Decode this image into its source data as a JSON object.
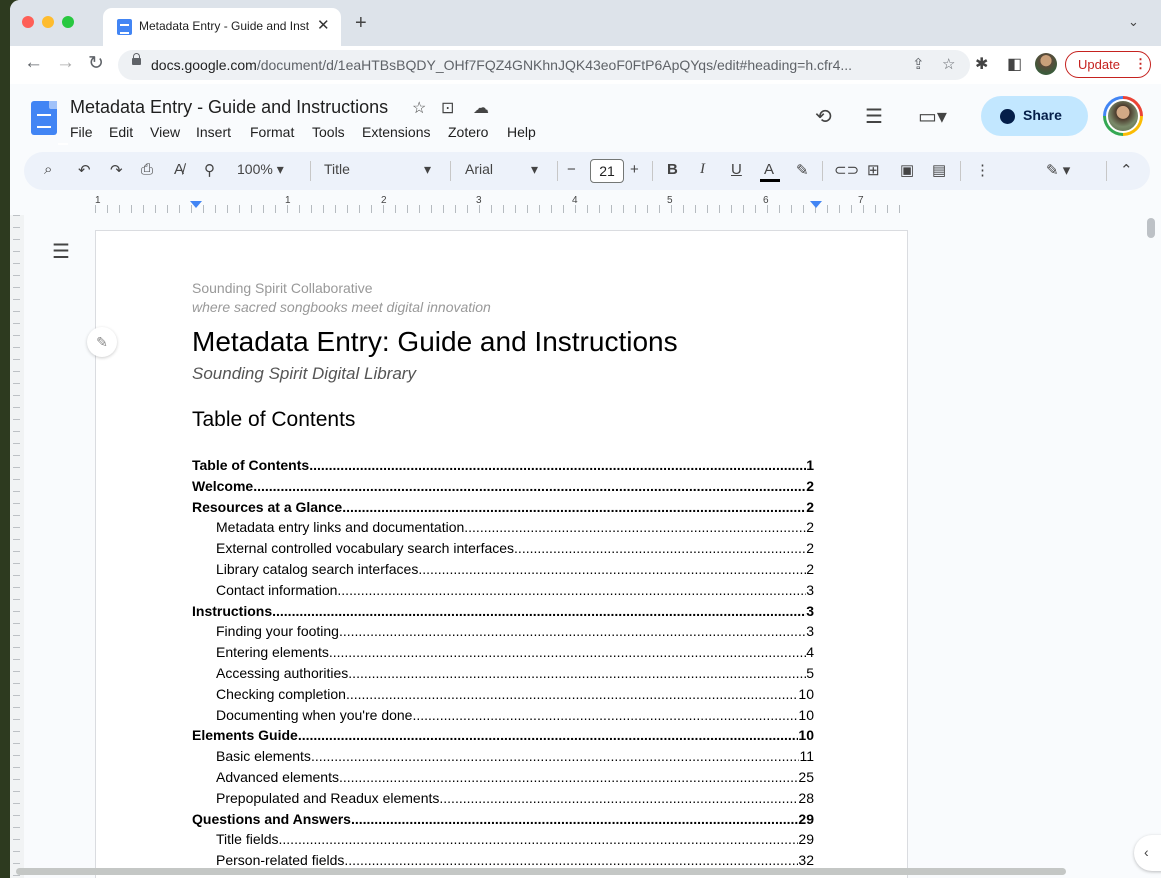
{
  "tab": {
    "title": "Metadata Entry - Guide and Instructions"
  },
  "browser": {
    "url_host": "docs.google.com",
    "url_path": "/document/d/1eaHTBsBQDY_OHf7FQZ4GNKhnJQK43eoF0FtP6ApQYqs/edit#heading=h.cfr4...",
    "update_label": "Update"
  },
  "docs": {
    "title": "Metadata Entry - Guide and Instructions",
    "menu": [
      "File",
      "Edit",
      "View",
      "Insert",
      "Format",
      "Tools",
      "Extensions",
      "Zotero",
      "Help"
    ],
    "share_label": "Share"
  },
  "toolbar": {
    "zoom": "100%",
    "style": "Title",
    "font": "Arial",
    "font_size": "21"
  },
  "ruler": {
    "numbers": [
      "1",
      "1",
      "2",
      "3",
      "4",
      "5",
      "6",
      "7"
    ]
  },
  "document": {
    "org_name": "Sounding Spirit Collaborative",
    "org_tagline": "where sacred songbooks meet digital innovation",
    "title": "Metadata Entry: Guide and Instructions",
    "subtitle": "Sounding Spirit Digital Library",
    "toc_heading": "Table of Contents",
    "toc": [
      {
        "text": "Table of Contents",
        "page": "1",
        "level": 1
      },
      {
        "text": "Welcome",
        "page": "2",
        "level": 1
      },
      {
        "text": "Resources at a Glance",
        "page": "2",
        "level": 1
      },
      {
        "text": "Metadata entry links and documentation",
        "page": "2",
        "level": 2
      },
      {
        "text": "External controlled vocabulary search interfaces",
        "page": "2",
        "level": 2
      },
      {
        "text": "Library catalog search interfaces",
        "page": "2",
        "level": 2
      },
      {
        "text": "Contact information",
        "page": "3",
        "level": 2
      },
      {
        "text": "Instructions",
        "page": "3",
        "level": 1
      },
      {
        "text": "Finding your footing",
        "page": "3",
        "level": 2
      },
      {
        "text": "Entering elements",
        "page": "4",
        "level": 2
      },
      {
        "text": "Accessing authorities",
        "page": "5",
        "level": 2
      },
      {
        "text": "Checking completion",
        "page": "10",
        "level": 2
      },
      {
        "text": "Documenting when you're done",
        "page": "10",
        "level": 2
      },
      {
        "text": "Elements Guide",
        "page": "10",
        "level": 1
      },
      {
        "text": "Basic elements",
        "page": "11",
        "level": 2
      },
      {
        "text": "Advanced elements",
        "page": "25",
        "level": 2
      },
      {
        "text": "Prepopulated and Readux elements",
        "page": "28",
        "level": 2
      },
      {
        "text": "Questions and Answers",
        "page": "29",
        "level": 1
      },
      {
        "text": "Title fields",
        "page": "29",
        "level": 2
      },
      {
        "text": "Person-related fields",
        "page": "32",
        "level": 2
      }
    ]
  },
  "colors": {
    "share_bg": "#c2e7ff",
    "update_red": "#c5221f",
    "docs_blue": "#4285f4"
  }
}
